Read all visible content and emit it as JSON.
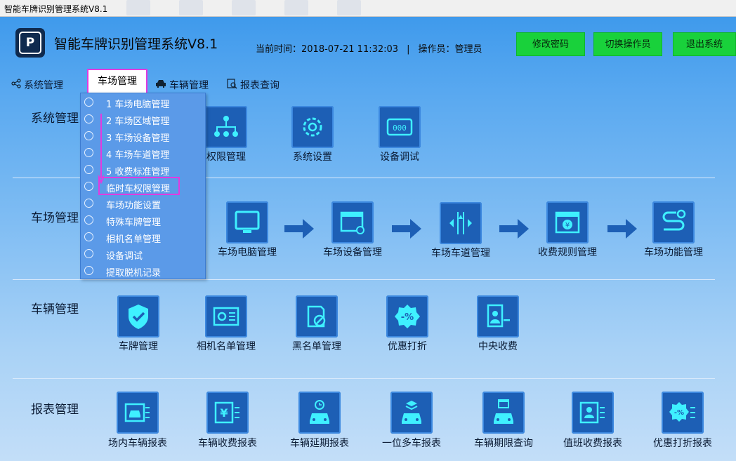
{
  "window": {
    "title": "智能车牌识别管理系统V8.1"
  },
  "header": {
    "logo_text": "P",
    "app_title": "智能车牌识别管理系统V8.1",
    "time_label": "当前时间：2018-07-21 11:32:03",
    "separator": "|",
    "operator_label": "操作员：管理员",
    "buttons": [
      "修改密码",
      "切换操作员",
      "退出系统"
    ]
  },
  "nav": {
    "items": [
      "系统管理",
      "车场管理",
      "车辆管理",
      "报表查询"
    ],
    "active": "车场管理"
  },
  "dropdown": {
    "items": [
      "1  车场电脑管理",
      "2  车场区域管理",
      "3  车场设备管理",
      "4  车场车道管理",
      "5  收费标准管理",
      "临时车权限管理",
      "车场功能设置",
      "特殊车牌管理",
      "相机名单管理",
      "设备调试",
      "提取脱机记录"
    ],
    "highlighted": "临时车权限管理"
  },
  "sections": [
    {
      "title": "系统管理",
      "tiles": [
        "权限管理",
        "系统设置",
        "设备调试"
      ]
    },
    {
      "title": "车场管理",
      "tiles": [
        "车场电脑管理",
        "车场设备管理",
        "车场车道管理",
        "收费规则管理",
        "车场功能管理"
      ]
    },
    {
      "title": "车辆管理",
      "tiles": [
        "车牌管理",
        "相机名单管理",
        "黑名单管理",
        "优惠打折",
        "中央收费"
      ]
    },
    {
      "title": "报表管理",
      "tiles": [
        "场内车辆报表",
        "车辆收费报表",
        "车辆延期报表",
        "一位多车报表",
        "车辆期限查询",
        "值班收费报表",
        "优惠打折报表"
      ]
    }
  ],
  "section1_partial_label": "权限管理",
  "colors": {
    "accent_green": "#19d13b",
    "tile_blue": "#1d5fb5",
    "highlight_pink": "#e23ae0",
    "icon_cyan": "#3ff0ff"
  }
}
